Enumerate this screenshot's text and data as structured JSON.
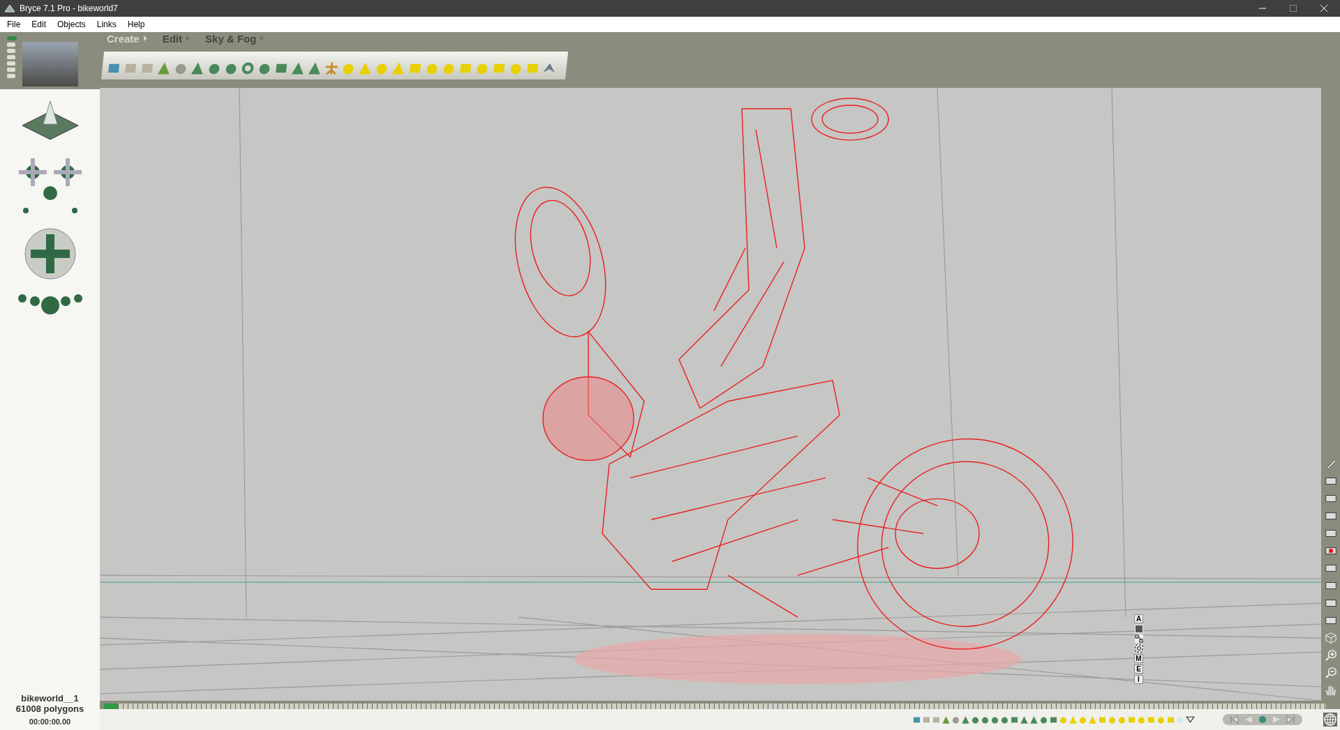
{
  "window": {
    "title": "Bryce 7.1  Pro - bikeworld7"
  },
  "menu": [
    "File",
    "Edit",
    "Objects",
    "Links",
    "Help"
  ],
  "palette_tabs": [
    {
      "label": "Create",
      "selected": true
    },
    {
      "label": "Edit",
      "selected": false
    },
    {
      "label": "Sky & Fog",
      "selected": false
    }
  ],
  "view_controls": [
    {
      "kind": "letter",
      "label": "A"
    },
    {
      "kind": "solid"
    },
    {
      "kind": "link"
    },
    {
      "kind": "target"
    },
    {
      "kind": "letter",
      "label": "M"
    },
    {
      "kind": "letter",
      "label": "E"
    },
    {
      "kind": "letter",
      "label": "I"
    }
  ],
  "status": {
    "object_name": "bikeworld__1",
    "polygons": "61008 polygons",
    "time": "00:00:00.00"
  }
}
